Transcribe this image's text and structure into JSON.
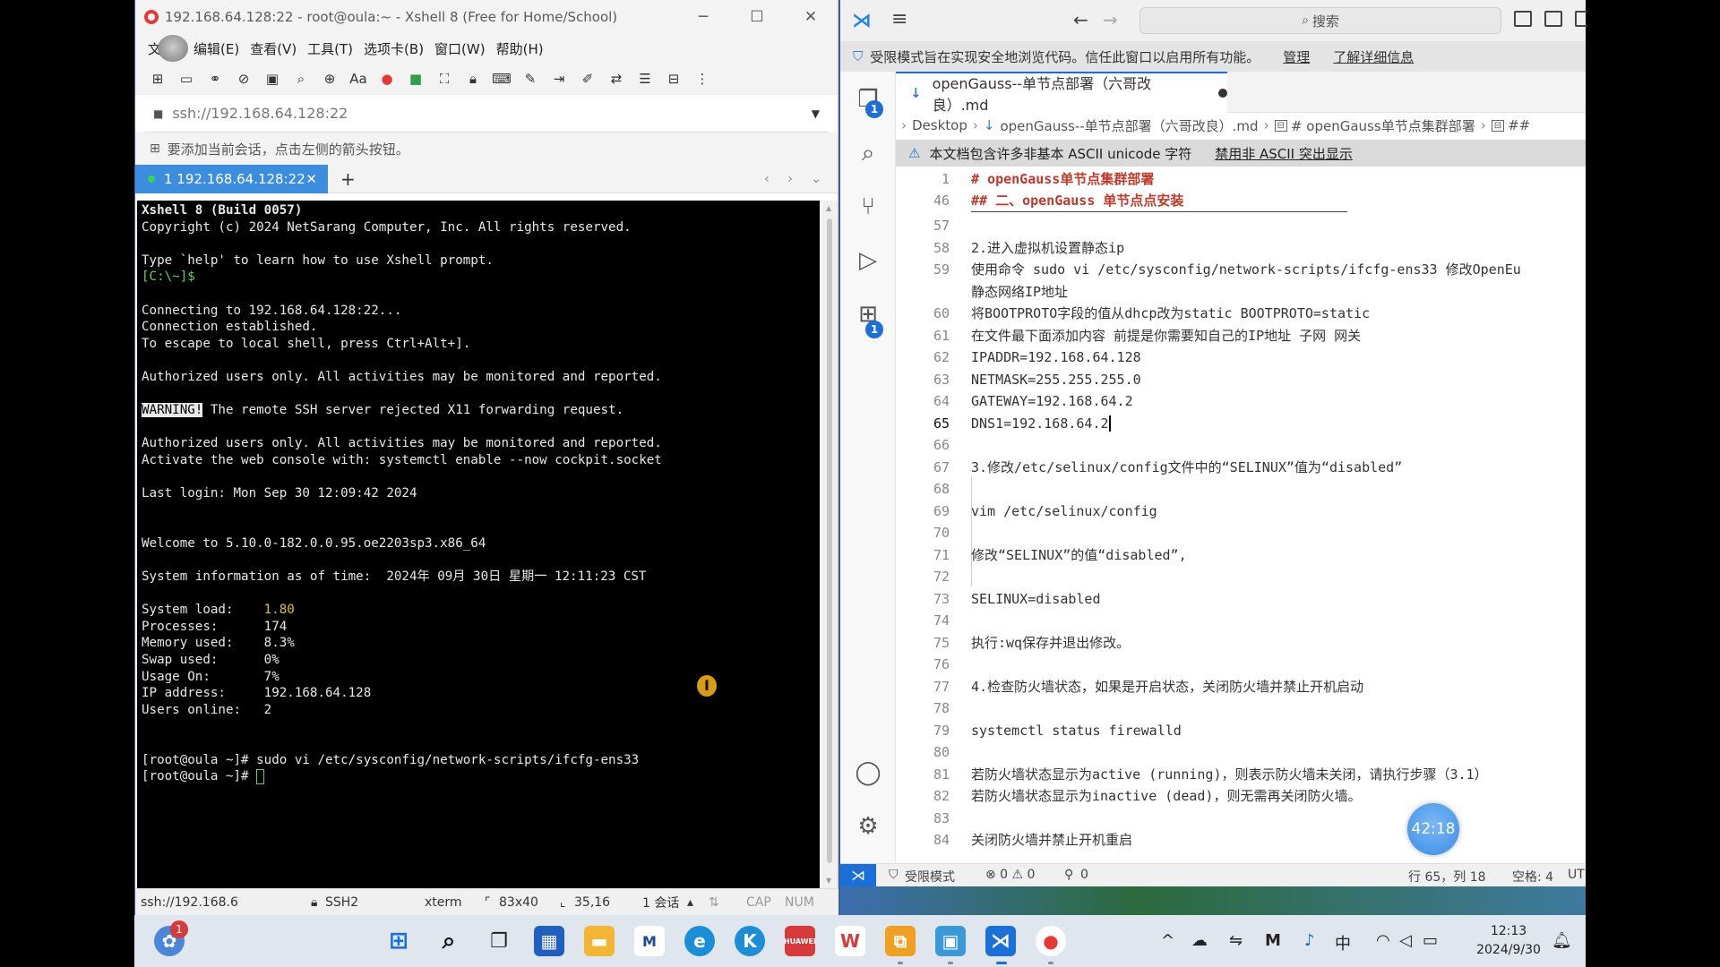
{
  "xshell": {
    "title": "192.168.64.128:22 - root@oula:~ - Xshell 8 (Free for Home/School)",
    "menu": [
      "文件(F)",
      "编辑(E)",
      "查看(V)",
      "工具(T)",
      "选项卡(B)",
      "窗口(W)",
      "帮助(H)"
    ],
    "menu_first_visible": "文",
    "address": "ssh://192.168.64.128:22",
    "hint": "要添加当前会话，点击左侧的箭头按钮。",
    "tab_label": "1 192.168.64.128:22",
    "terminal_lines": [
      "Xshell 8 (Build 0057)",
      "Copyright (c) 2024 NetSarang Computer, Inc. All rights reserved.",
      "",
      "Type `help' to learn how to use Xshell prompt.",
      "[C:\\~]$",
      "",
      "Connecting to 192.168.64.128:22...",
      "Connection established.",
      "To escape to local shell, press Ctrl+Alt+].",
      "",
      "Authorized users only. All activities may be monitored and reported.",
      "",
      "WARNING!| The remote SSH server rejected X11 forwarding request.",
      "",
      "Authorized users only. All activities may be monitored and reported.",
      "Activate the web console with: systemctl enable --now cockpit.socket",
      "",
      "Last login: Mon Sep 30 12:09:42 2024",
      "",
      "",
      "Welcome to 5.10.0-182.0.0.95.oe2203sp3.x86_64",
      "",
      "System information as of time:  2024年 09月 30日 星期一 12:11:23 CST",
      "",
      "System load:    |1.80",
      "Processes:      174",
      "Memory used:    8.3%",
      "Swap used:      0%",
      "Usage On:       7%",
      "IP address:     192.168.64.128",
      "Users online:   2",
      "",
      "",
      "[root@oula ~]# sudo vi /etc/sysconfig/network-scripts/ifcfg-ens33",
      "[root@oula ~]# "
    ],
    "status": {
      "conn": "ssh://192.168.6",
      "proto": "SSH2",
      "term": "xterm",
      "size": "83x40",
      "pos": "35,16",
      "sessions": "1 会话",
      "cap": "CAP",
      "num": "NUM"
    }
  },
  "vscode": {
    "search": "搜索",
    "restricted_text": "受限模式旨在实现安全地浏览代码。信任此窗口以启用所有功能。",
    "restricted_manage": "管理",
    "restricted_learn": "了解详细信息",
    "tab_title": "openGauss--单节点部署（六哥改良）.md",
    "breadcrumb": [
      "Desktop",
      "openGauss--单节点部署（六哥改良）.md",
      "# openGauss单节点集群部署",
      "##"
    ],
    "unicode_warning": "本文档包含许多非基本 ASCII unicode 字符",
    "unicode_disable": "禁用非 ASCII 突出显示",
    "sticky": [
      {
        "n": "1",
        "t": "# openGauss单节点集群部署"
      },
      {
        "n": "46",
        "t": "## 二、openGauss 单节点点安装"
      }
    ],
    "lines": [
      {
        "n": "57",
        "t": ""
      },
      {
        "n": "58",
        "t": "2.进入虚拟机设置静态ip"
      },
      {
        "n": "59",
        "t": "使用命令 sudo vi /etc/sysconfig/network-scripts/ifcfg-ens33 修改OpenEu"
      },
      {
        "n": "",
        "t": "静态网络IP地址"
      },
      {
        "n": "60",
        "t": "将BOOTPROTO字段的值从dhcp改为static  BOOTPROTO=static"
      },
      {
        "n": "61",
        "t": "在文件最下面添加内容      前提是你需要知自己的IP地址 子网 网关"
      },
      {
        "n": "62",
        "t": "IPADDR=192.168.64.128"
      },
      {
        "n": "63",
        "t": "NETMASK=255.255.255.0"
      },
      {
        "n": "64",
        "t": "GATEWAY=192.168.64.2"
      },
      {
        "n": "65",
        "t": "DNS1=192.168.64.2"
      },
      {
        "n": "66",
        "t": ""
      },
      {
        "n": "67",
        "t": "3.修改/etc/selinux/config文件中的“SELINUX”值为“disabled”"
      },
      {
        "n": "68",
        "t": ""
      },
      {
        "n": "69",
        "t": "   vim /etc/selinux/config"
      },
      {
        "n": "70",
        "t": ""
      },
      {
        "n": "71",
        "t": "  修改“SELINUX”的值“disabled”,"
      },
      {
        "n": "72",
        "t": ""
      },
      {
        "n": "73",
        "t": "  SELINUX=disabled"
      },
      {
        "n": "74",
        "t": ""
      },
      {
        "n": "75",
        "t": "  执行:wq保存并退出修改。"
      },
      {
        "n": "76",
        "t": ""
      },
      {
        "n": "77",
        "t": "4.检查防火墙状态，如果是开启状态，关闭防火墙并禁止开机启动"
      },
      {
        "n": "78",
        "t": ""
      },
      {
        "n": "79",
        "t": "systemctl status firewalld"
      },
      {
        "n": "80",
        "t": ""
      },
      {
        "n": "81",
        "t": "若防火墙状态显示为active (running)，则表示防火墙未关闭，请执行步骤（3.1）"
      },
      {
        "n": "82",
        "t": "若防火墙状态显示为inactive (dead)，则无需再关闭防火墙。"
      },
      {
        "n": "83",
        "t": ""
      },
      {
        "n": "84",
        "t": "关闭防火墙并禁止开机重启"
      }
    ],
    "status": {
      "restricted": "受限模式",
      "problems": "⊗ 0 ⚠ 0",
      "ports": "0",
      "position": "行 65，列 18",
      "spaces": "空格: 4",
      "encoding": "UT"
    },
    "timer": "42:18",
    "badges": {
      "explorer": "1",
      "extensions": "1"
    }
  },
  "taskbar": {
    "notification_count": "1",
    "clock_time": "12:13",
    "clock_date": "2024/9/30",
    "ime": "中",
    "huawei": "HUAWEI"
  }
}
